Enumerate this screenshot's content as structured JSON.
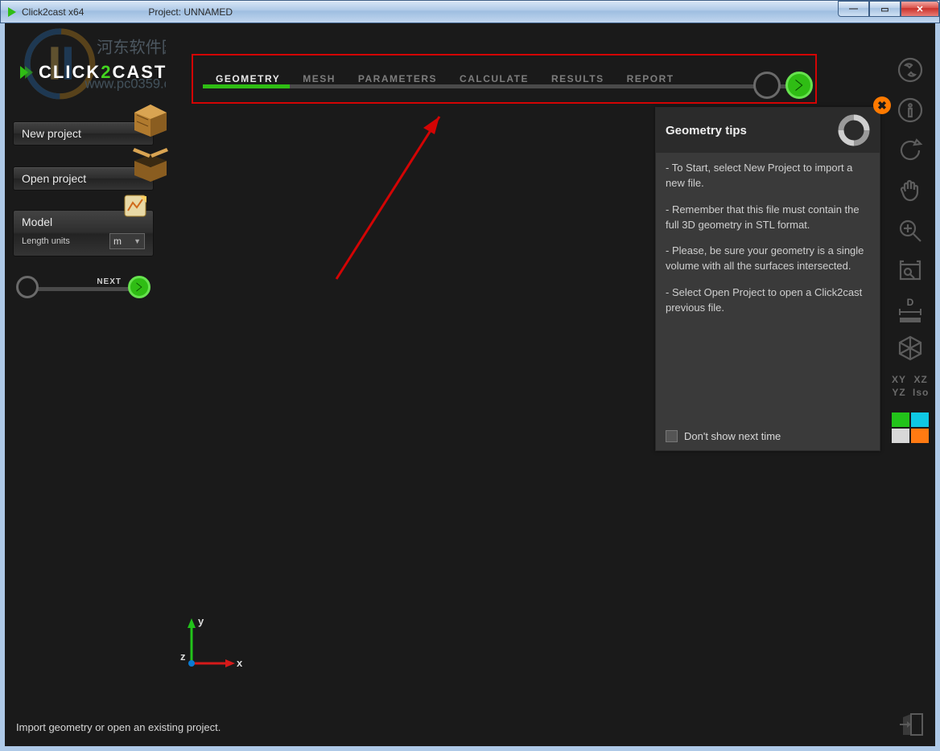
{
  "window": {
    "title": "Click2cast x64",
    "project_label": "Project: UNNAMED"
  },
  "brand": {
    "part1": "CLICK",
    "part2": "2",
    "part3": "CAST"
  },
  "workflow": {
    "tabs": [
      "GEOMETRY",
      "MESH",
      "PARAMETERS",
      "CALCULATE",
      "RESULTS",
      "REPORT"
    ],
    "active_index": 0
  },
  "sidebar": {
    "new_project": "New project",
    "open_project": "Open project",
    "model_title": "Model",
    "length_units_label": "Length units",
    "length_units_value": "m",
    "next_label": "NEXT"
  },
  "tips": {
    "title": "Geometry tips",
    "p1": "- To Start, select New Project to import a new file.",
    "p2": "- Remember that this file must contain the full 3D geometry in STL format.",
    "p3": "- Please, be sure your geometry is a single volume with all the surfaces intersected.",
    "p4": "- Select Open Project to open a Click2cast previous file.",
    "dont_show": "Don't show next time"
  },
  "right_tools": {
    "views": {
      "xy": "XY",
      "xz": "XZ",
      "yz": "YZ",
      "iso": "Iso"
    },
    "d_label": "D"
  },
  "axes": {
    "x": "x",
    "y": "y",
    "z": "z"
  },
  "statusbar": {
    "message": "Import geometry or open an existing project."
  }
}
